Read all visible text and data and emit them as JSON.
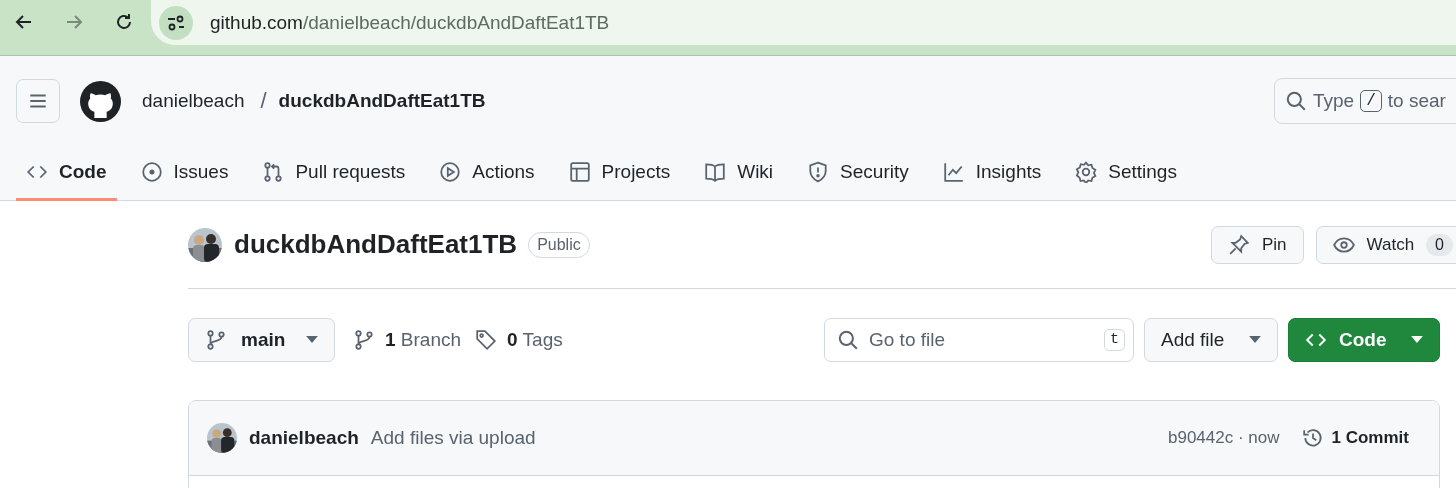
{
  "browser": {
    "url_host": "github.com",
    "url_path": "/danielbeach/duckdbAndDaftEat1TB"
  },
  "header": {
    "owner": "danielbeach",
    "separator": "/",
    "repo": "duckdbAndDaftEat1TB",
    "search": {
      "placeholder_start": "Type",
      "key": "/",
      "placeholder_end": "to sear"
    }
  },
  "tabs": [
    {
      "label": "Code",
      "selected": true
    },
    {
      "label": "Issues",
      "selected": false
    },
    {
      "label": "Pull requests",
      "selected": false
    },
    {
      "label": "Actions",
      "selected": false
    },
    {
      "label": "Projects",
      "selected": false
    },
    {
      "label": "Wiki",
      "selected": false
    },
    {
      "label": "Security",
      "selected": false
    },
    {
      "label": "Insights",
      "selected": false
    },
    {
      "label": "Settings",
      "selected": false
    }
  ],
  "repo": {
    "name": "duckdbAndDaftEat1TB",
    "visibility": "Public",
    "pin": "Pin",
    "watch": {
      "label": "Watch",
      "count": "0"
    }
  },
  "toolbar": {
    "branch": "main",
    "branches": "**1** Branch",
    "tags": "**0** Tags",
    "go_to_file": {
      "placeholder": "Go to file",
      "key": "t"
    },
    "add_file": "Add file",
    "code": "Code"
  },
  "commit": {
    "author": "danielbeach",
    "message": "Add files via upload",
    "hash_time": "b90442c · now",
    "commits": "1 Commit"
  }
}
